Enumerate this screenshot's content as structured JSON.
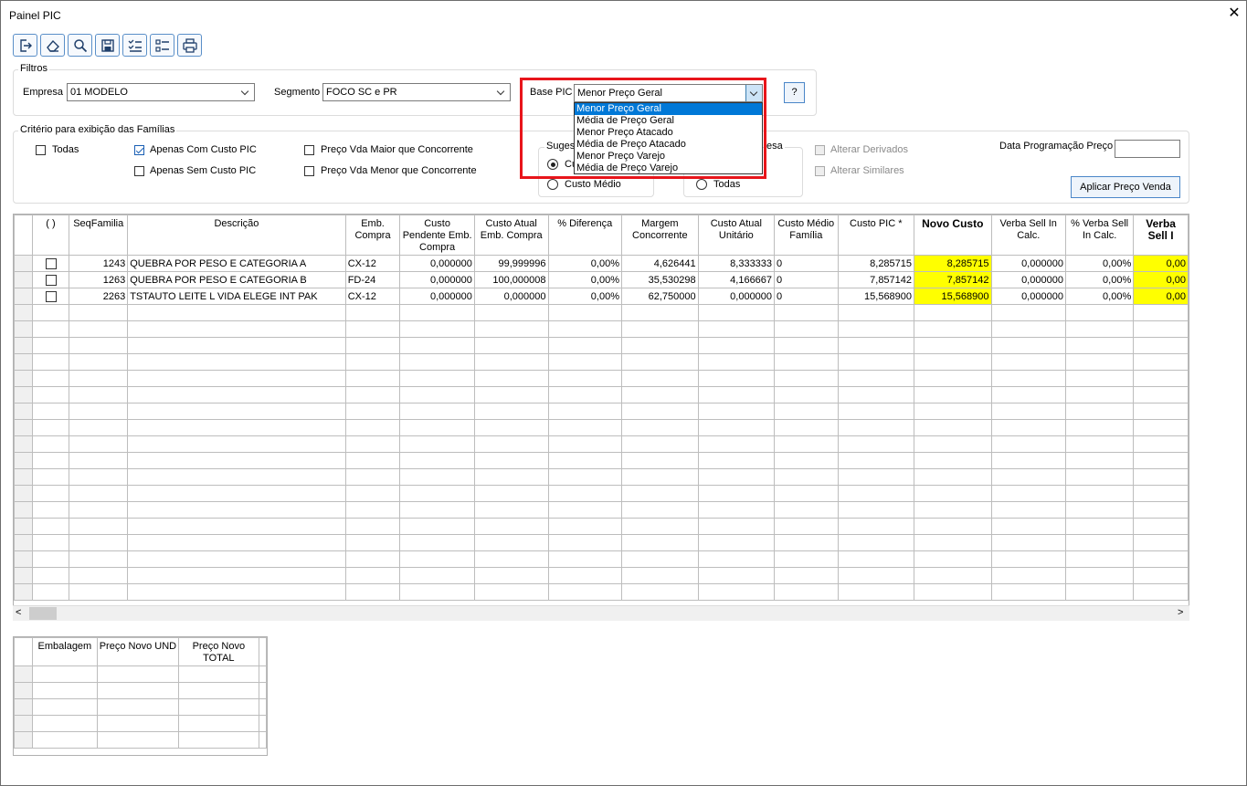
{
  "window": {
    "title": "Painel PIC",
    "close": "✕"
  },
  "toolbar": [
    "exit-icon",
    "eraser-icon",
    "search-icon",
    "save-icon",
    "checklist-icon",
    "list-icon",
    "print-icon"
  ],
  "filtros": {
    "label": "Filtros",
    "empresa_label": "Empresa",
    "empresa_value": "01 MODELO",
    "segmento_label": "Segmento",
    "segmento_value": "FOCO SC e PR",
    "base_label": "Base PIC",
    "base_value": "Menor Preço Geral",
    "base_options": [
      "Menor Preço Geral",
      "Média de Preço Geral",
      "Menor Preço Atacado",
      "Média de Preço Atacado",
      "Menor Preço Varejo",
      "Média de Preço Varejo"
    ],
    "help": "?"
  },
  "criterio": {
    "label": "Critério para exibição das Famílias",
    "todas": "Todas",
    "apenas_com": "Apenas Com Custo PIC",
    "apenas_sem": "Apenas Sem Custo PIC",
    "maior": "Preço Vda Maior que Concorrente",
    "menor": "Preço Vda Menor que Concorrente"
  },
  "sugestao": {
    "label": "Suges",
    "opt1": "Cu",
    "opt2": "Custo Médio"
  },
  "empresa_group": {
    "label": "esa",
    "todas": "Todas"
  },
  "alterar_derivados": "Alterar Derivados",
  "alterar_similares": "Alterar Similares",
  "data_programacao": {
    "label": "Data Programação Preço",
    "value": ""
  },
  "aplicar_button": "Aplicar Preço Venda",
  "grid": {
    "headers": [
      "( )",
      "SeqFamilia",
      "Descrição",
      "Emb. Compra",
      "Custo Pendente Emb. Compra",
      "Custo Atual Emb. Compra",
      "% Diferença",
      "Margem Concorrente",
      "Custo Atual Unitário",
      "Custo Médio Família",
      "Custo PIC *",
      "Novo Custo",
      "Verba Sell In Calc.",
      "% Verba Sell In Calc.",
      "Verba Sell I"
    ],
    "rows": [
      [
        "1243",
        "QUEBRA POR PESO E CATEGORIA A",
        "CX-12",
        "0,000000",
        "99,999996",
        "0,00%",
        "4,626441",
        "8,333333",
        "0",
        "8,285715",
        "8,285715",
        "0,000000",
        "0,00%",
        "0,00"
      ],
      [
        "1263",
        "QUEBRA POR PESO E CATEGORIA B",
        "FD-24",
        "0,000000",
        "100,000008",
        "0,00%",
        "35,530298",
        "4,166667",
        "0",
        "7,857142",
        "7,857142",
        "0,000000",
        "0,00%",
        "0,00"
      ],
      [
        "2263",
        "TSTAUTO  LEITE L VIDA ELEGE INT PAK",
        "CX-12",
        "0,000000",
        "0,000000",
        "0,00%",
        "62,750000",
        "0,000000",
        "0",
        "15,568900",
        "15,568900",
        "0,000000",
        "0,00%",
        "0,00"
      ]
    ],
    "scroll_left": "<",
    "scroll_right": ">"
  },
  "grid2": {
    "headers": [
      "Embalagem",
      "Preço Novo UND",
      "Preço Novo TOTAL"
    ]
  }
}
